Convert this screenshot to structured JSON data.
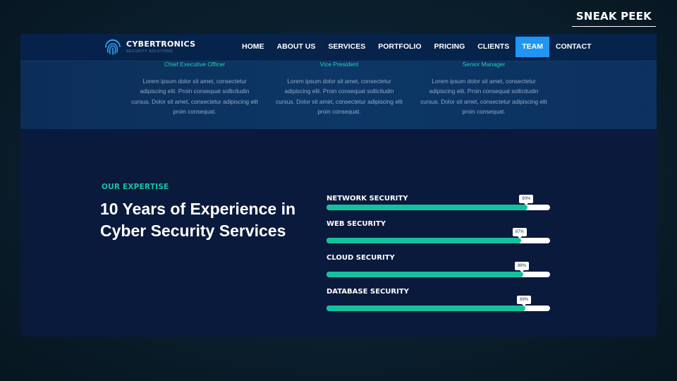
{
  "badge": {
    "label": "SNEAK PEEK"
  },
  "site": {
    "logo_name": "CYBERTRONICS",
    "logo_tagline": "SECURITY SOLUTIONS"
  },
  "nav": {
    "items": [
      "HOME",
      "ABOUT US",
      "SERVICES",
      "PORTFOLIO",
      "PRICING",
      "CLIENTS",
      "TEAM",
      "CONTACT"
    ],
    "active": "TEAM"
  },
  "team": {
    "members": [
      {
        "role": "Chief Executive Officer",
        "bio": "Lorem ipsum dolor sit amet, consectetur adipiscing elit. Proin consequat sollicitudin cursus. Dolor sit amet, consectetur adipiscing elit proin consequat."
      },
      {
        "role": "Vice President",
        "bio": "Lorem ipsum dolor sit amet, consectetur adipiscing elit. Proin consequat sollicitudin cursus. Dolor sit amet, consectetur adipiscing elit proin consequat."
      },
      {
        "role": "Senior Manager",
        "bio": "Lorem ipsum dolor sit amet, consectetur adipiscing elit. Proin consequat sollicitudin cursus. Dolor sit amet, consectetur adipiscing elit proin consequat."
      }
    ]
  },
  "expertise": {
    "label": "OUR EXPERTISE",
    "headline": "10 Years of Experience in Cyber Security Services",
    "skills": [
      {
        "name": "NETWORK SECURITY",
        "percent_label": "90%",
        "percent": 90
      },
      {
        "name": "WEB SECURITY",
        "percent_label": "87%",
        "percent": 87
      },
      {
        "name": "CLOUD SECURITY",
        "percent_label": "88%",
        "percent": 88
      },
      {
        "name": "DATABASE SECURITY",
        "percent_label": "89%",
        "percent": 89
      }
    ]
  },
  "colors": {
    "accent_teal": "#14c19e",
    "nav_active": "#2096f2",
    "role_text": "#24d0b2"
  },
  "icons": {
    "logo": "fingerprint-icon"
  }
}
